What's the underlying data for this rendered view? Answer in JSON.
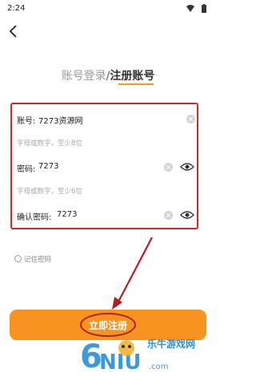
{
  "status": {
    "time": "2:24"
  },
  "header": {
    "title_login": "账号登录",
    "title_sep": "/",
    "title_register": "注册账号"
  },
  "form": {
    "account": {
      "label": "账号:",
      "value": "7273资源网",
      "hint": "字母或数字，至少8位"
    },
    "password": {
      "label": "密码:",
      "value": "7273",
      "hint": "字母或数字，至少6位"
    },
    "confirm": {
      "label": "确认密码:",
      "value": "7273"
    }
  },
  "remember": {
    "label": "记住密码"
  },
  "submit": {
    "label": "立即注册"
  },
  "watermark": {
    "text": "乐牛游戏网",
    "logo_text": "6NIU.com"
  },
  "colors": {
    "accent": "#f7931e",
    "annotation": "#d12a2a"
  },
  "icons": [
    "wifi-icon",
    "battery-icon",
    "back-arrow-icon",
    "clear-icon",
    "eye-icon"
  ]
}
